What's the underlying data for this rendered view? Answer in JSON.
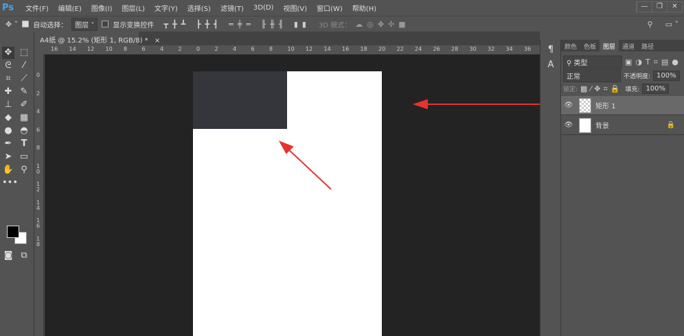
{
  "app": {
    "logo": "Ps",
    "menus": [
      "文件(F)",
      "编辑(E)",
      "图像(I)",
      "图层(L)",
      "文字(Y)",
      "选择(S)",
      "滤镜(T)",
      "3D(D)",
      "视图(V)",
      "窗口(W)",
      "帮助(H)"
    ],
    "window_controls": [
      "—",
      "❐",
      "✕"
    ]
  },
  "options": {
    "auto_select_label": "自动选择：",
    "auto_select_value": "图层",
    "show_transform_label": "显示变换控件",
    "mode_3d_label": "3D 模式："
  },
  "document_tab": {
    "title": "A4纸 @ 15.2% (矩形 1, RGB/8) *",
    "close": "×"
  },
  "rulers": {
    "horizontal": [
      "16",
      "14",
      "12",
      "10",
      "8",
      "6",
      "4",
      "2",
      "0",
      "2",
      "4",
      "6",
      "8",
      "10",
      "12",
      "14",
      "16",
      "18",
      "20",
      "22",
      "24",
      "26",
      "28",
      "30",
      "32",
      "34",
      "36"
    ],
    "vertical": [
      "0",
      "2",
      "4",
      "6",
      "8",
      "10",
      "12",
      "14",
      "16",
      "18"
    ]
  },
  "layers_panel": {
    "tabs": [
      "颜色",
      "色板",
      "图层",
      "通道",
      "路径"
    ],
    "active_tab": "图层",
    "filter_kind": "类型",
    "blend_mode": "正常",
    "opacity_label": "不透明度:",
    "opacity_value": "100%",
    "lock_label": "锁定:",
    "fill_label": "填充:",
    "fill_value": "100%",
    "layers": [
      {
        "name": "矩形 1",
        "selected": true
      },
      {
        "name": "背景",
        "locked": true
      }
    ]
  },
  "colors": {
    "accent_red": "#e8322e",
    "rect": "#34363b",
    "canvas_bg": "#232323"
  }
}
